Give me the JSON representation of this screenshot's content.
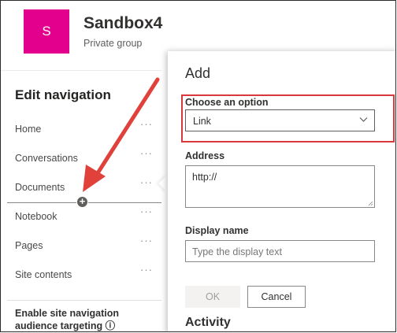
{
  "site": {
    "logo_letter": "S",
    "title": "Sandbox4",
    "subtitle": "Private group"
  },
  "nav": {
    "heading": "Edit navigation",
    "items": [
      {
        "label": "Home",
        "more": "···"
      },
      {
        "label": "Conversations",
        "more": "···"
      },
      {
        "label": "Documents",
        "more": "···"
      },
      {
        "label": "Notebook",
        "more": "···"
      },
      {
        "label": "Pages",
        "more": "···"
      },
      {
        "label": "Site contents",
        "more": "···"
      }
    ],
    "insert_symbol": "+",
    "footer_text": "Enable site navigation audience targeting ⓘ"
  },
  "dialog": {
    "title": "Add",
    "choose_label": "Choose an option",
    "choose_value": "Link",
    "address_label": "Address",
    "address_value": "http://",
    "display_label": "Display name",
    "display_placeholder": "Type the display text",
    "ok_label": "OK",
    "cancel_label": "Cancel",
    "under_text": "Activity"
  },
  "colors": {
    "logo": "#e3008c",
    "highlight": "#d9383d",
    "arrow": "#e0413b"
  }
}
